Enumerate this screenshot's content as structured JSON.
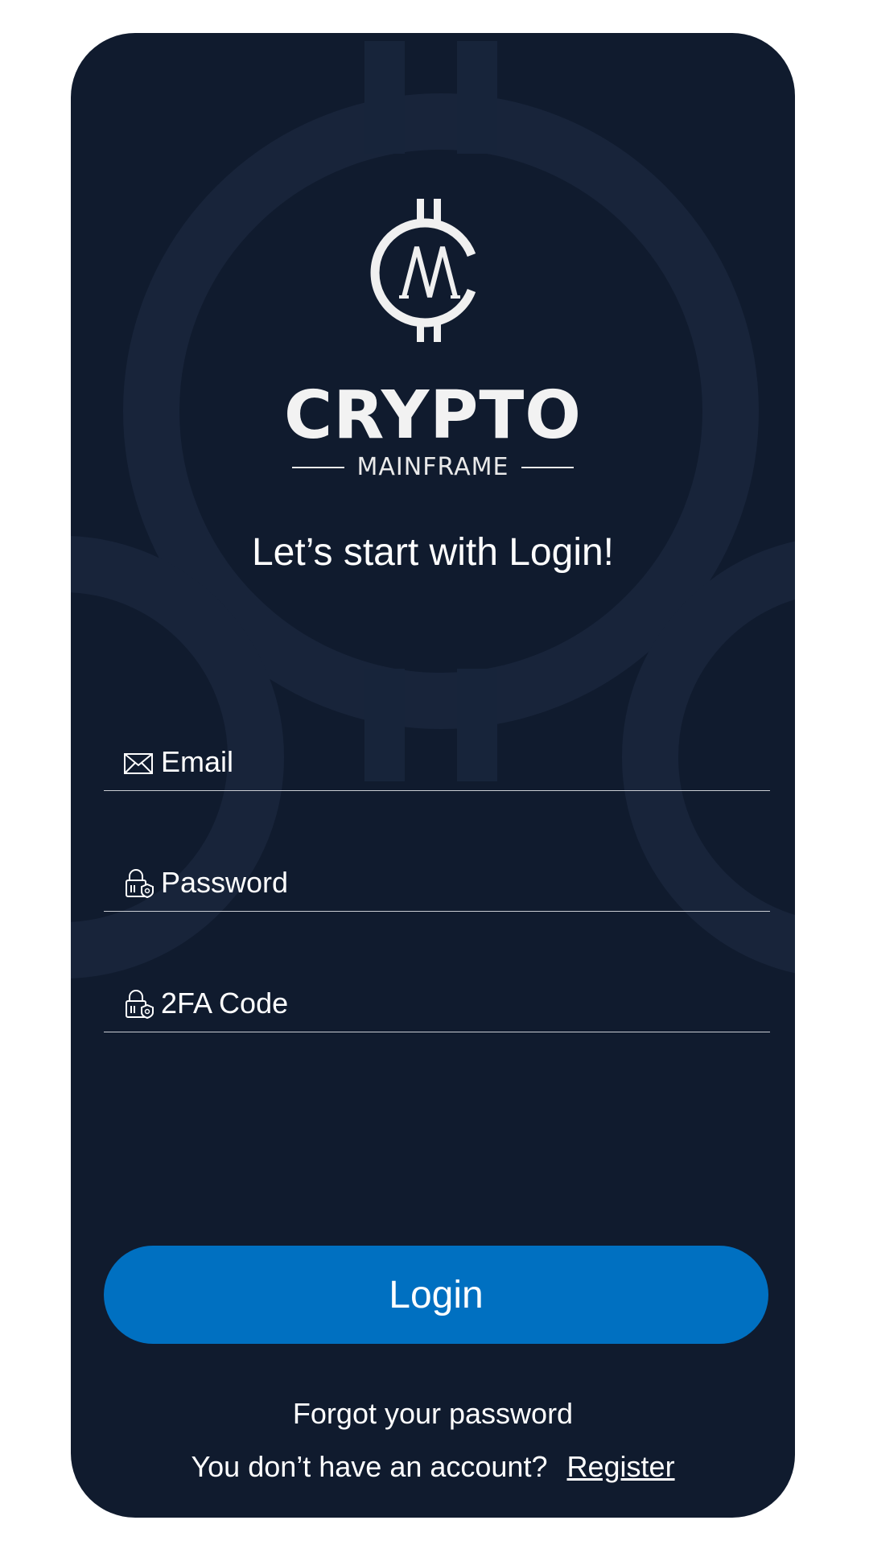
{
  "brand": {
    "name": "CRYPTO",
    "tagline": "MAINFRAME",
    "logo_icon": "bitcoin-m-icon"
  },
  "headline": "Let’s start with Login!",
  "form": {
    "email": {
      "placeholder": "Email",
      "value": "",
      "icon": "envelope-icon"
    },
    "password": {
      "placeholder": "Password",
      "value": "",
      "icon": "lock-shield-icon"
    },
    "twofa": {
      "placeholder": "2FA Code",
      "value": "",
      "icon": "lock-shield-icon"
    }
  },
  "actions": {
    "login_label": "Login",
    "forgot_label": "Forgot your password",
    "no_account_text": "You don’t have an account?",
    "register_label": "Register"
  },
  "colors": {
    "background": "#101b2e",
    "accent": "#0070c1",
    "text": "#ffffff"
  }
}
